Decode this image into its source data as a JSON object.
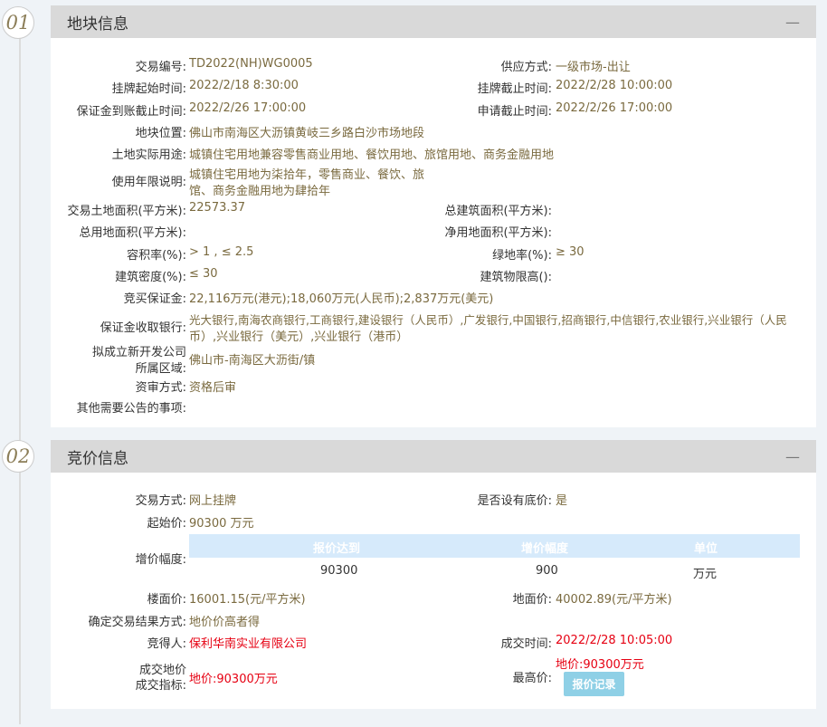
{
  "section1": {
    "number": "01",
    "title": "地块信息",
    "collapse_icon": "—",
    "rows": {
      "trade_no": {
        "label": "交易编号:",
        "value": "TD2022(NH)WG0005"
      },
      "supply_mode": {
        "label": "供应方式:",
        "value": "一级市场-出让"
      },
      "listing_start": {
        "label": "挂牌起始时间:",
        "value": "2022/2/18 8:30:00"
      },
      "listing_end": {
        "label": "挂牌截止时间:",
        "value": "2022/2/28 10:00:00"
      },
      "deposit_deadline": {
        "label": "保证金到账截止时间:",
        "value": "2022/2/26 17:00:00"
      },
      "apply_deadline": {
        "label": "申请截止时间:",
        "value": "2022/2/26 17:00:00"
      },
      "location": {
        "label": "地块位置:",
        "value": "佛山市南海区大沥镇黄岐三乡路白沙市场地段"
      },
      "usage": {
        "label": "土地实际用途:",
        "value": "城镇住宅用地兼容零售商业用地、餐饮用地、旅馆用地、商务金融用地"
      },
      "term_label": "使用年限说明:",
      "term_line1": "城镇住宅用地为柒拾年，零售商业、餐饮、旅",
      "term_line2": "馆、商务金融用地为肆拾年",
      "land_area": {
        "label": "交易土地面积(平方米):",
        "value": "22573.37"
      },
      "total_build_area": {
        "label": "总建筑面积(平方米):",
        "value": ""
      },
      "total_used_area": {
        "label": "总用地面积(平方米):",
        "value": ""
      },
      "net_land_area": {
        "label": "净用地面积(平方米):",
        "value": ""
      },
      "far": {
        "label": "容积率(%):",
        "value": "> 1 , ≤ 2.5"
      },
      "green_rate": {
        "label": "绿地率(%):",
        "value": "≥ 30"
      },
      "density": {
        "label": "建筑密度(%):",
        "value": "≤ 30"
      },
      "height_limit": {
        "label": "建筑物限高():",
        "value": ""
      },
      "bid_deposit": {
        "label": "竞买保证金:",
        "value": "22,116万元(港元);18,060万元(人民币);2,837万元(美元)"
      },
      "bank_label": "保证金收取银行:",
      "bank_line1": "光大银行,南海农商银行,工商银行,建设银行（人民币）,广发银行,中国银行,招商银行,中信银行,农业银行,兴业银行（人民",
      "bank_line2": "币）,兴业银行（美元）,兴业银行（港币）",
      "company_label1": "拟成立新开发公司",
      "company_label2": "所属区域:",
      "company_value": "佛山市-南海区大沥街/镇",
      "review": {
        "label": "资审方式:",
        "value": "资格后审"
      },
      "other": {
        "label": "其他需要公告的事项:",
        "value": ""
      }
    }
  },
  "section2": {
    "number": "02",
    "title": "竞价信息",
    "collapse_icon": "—",
    "trade_mode": {
      "label": "交易方式:",
      "value": "网上挂牌"
    },
    "reserve": {
      "label": "是否设有底价:",
      "value": "是"
    },
    "start_price": {
      "label": "起始价:",
      "value": "90300 万元"
    },
    "increment_label": "增价幅度:",
    "increment_table": {
      "headers": [
        "报价达到",
        "增价幅度",
        "单位"
      ],
      "row": [
        "90300",
        "900",
        "万元"
      ]
    },
    "floor_price": {
      "label": "楼面价:",
      "value": "16001.15(元/平方米)"
    },
    "land_price": {
      "label": "地面价:",
      "value": "40002.89(元/平方米)"
    },
    "result_mode": {
      "label": "确定交易结果方式:",
      "value": "地价价高者得"
    },
    "winner": {
      "label": "竞得人:",
      "value": "保利华南实业有限公司"
    },
    "deal_time": {
      "label": "成交时间:",
      "value": "2022/2/28 10:05:00"
    },
    "deal_label1": "成交地价",
    "deal_label2": "成交指标:",
    "deal_value": "地价:90300万元",
    "max_price": {
      "label": "最高价:",
      "value": "地价:90300万元"
    },
    "record_button": "报价记录"
  }
}
